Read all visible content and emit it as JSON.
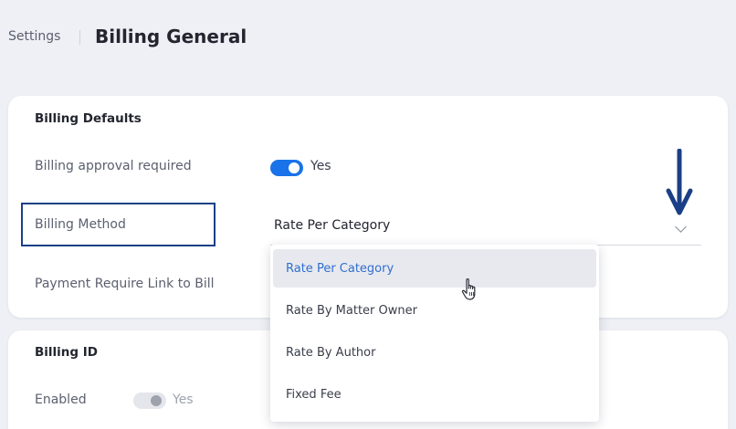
{
  "header": {
    "breadcrumb": "Settings",
    "title": "Billing General"
  },
  "billing_defaults": {
    "section_title": "Billing Defaults",
    "approval_label": "Billing approval required",
    "approval_value": "Yes",
    "approval_on": true,
    "method_label": "Billing Method",
    "method_value": "Rate Per Category",
    "payment_link_label": "Payment Require Link to Bill"
  },
  "dropdown": {
    "options": [
      {
        "label": "Rate Per Category",
        "selected": true
      },
      {
        "label": "Rate By Matter Owner",
        "selected": false
      },
      {
        "label": "Rate By Author",
        "selected": false
      },
      {
        "label": "Fixed Fee",
        "selected": false
      }
    ]
  },
  "billing_id": {
    "section_title": "Billing ID",
    "enabled_label": "Enabled",
    "enabled_value": "Yes",
    "enabled_on": false
  },
  "colors": {
    "accent": "#1a73e8",
    "highlight_border": "#1b3f86",
    "selected_option_text": "#2f6fcf",
    "annotation_arrow": "#1b3f86"
  },
  "icons": {
    "chevron": "chevron-down-icon",
    "arrow": "arrow-down-icon",
    "cursor": "hand-pointer-icon"
  }
}
